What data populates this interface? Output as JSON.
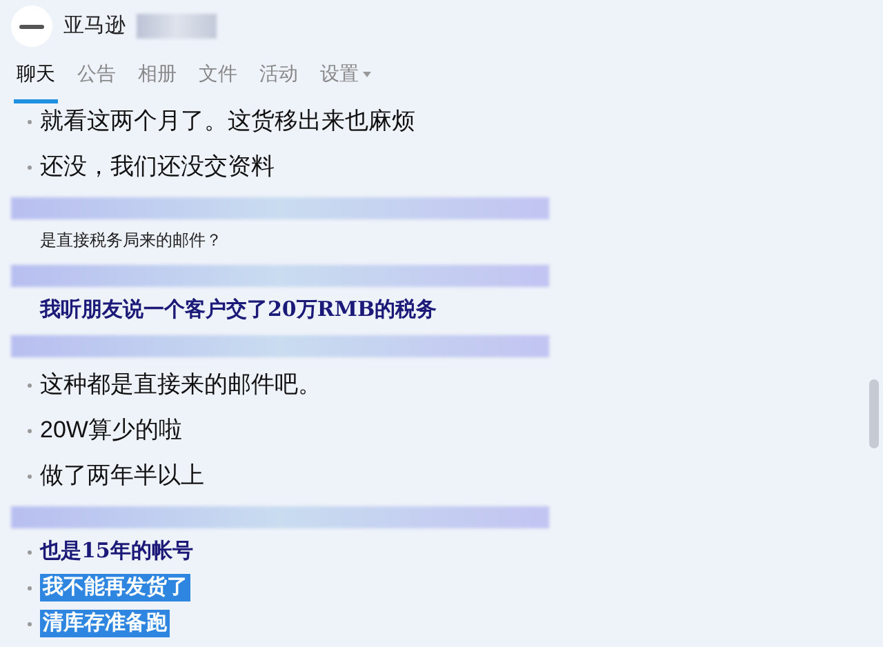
{
  "header": {
    "title": "亚马逊"
  },
  "tabs": [
    {
      "label": "聊天",
      "selected": true
    },
    {
      "label": "公告",
      "selected": false
    },
    {
      "label": "相册",
      "selected": false
    },
    {
      "label": "文件",
      "selected": false
    },
    {
      "label": "活动",
      "selected": false
    },
    {
      "label": "设置",
      "selected": false,
      "dropdown": true
    }
  ],
  "messages": [
    {
      "kind": "plain",
      "bullet": true,
      "selected": false,
      "text": "就看这两个月了。这货移出来也麻烦"
    },
    {
      "kind": "plain",
      "bullet": true,
      "selected": false,
      "text": "还没，我们还没交资料"
    },
    {
      "kind": "redacted"
    },
    {
      "kind": "small",
      "bullet": false,
      "selected": false,
      "text": "是直接税务局来的邮件？"
    },
    {
      "kind": "redacted"
    },
    {
      "kind": "emphasis",
      "bullet": false,
      "selected": false,
      "text": "我听朋友说一个客户交了20万RMB的税务"
    },
    {
      "kind": "redacted"
    },
    {
      "kind": "plain",
      "bullet": true,
      "selected": false,
      "text": "这种都是直接来的邮件吧。"
    },
    {
      "kind": "plain",
      "bullet": true,
      "selected": false,
      "text": "20W算少的啦"
    },
    {
      "kind": "plain",
      "bullet": true,
      "selected": false,
      "text": "做了两年半以上"
    },
    {
      "kind": "redacted"
    },
    {
      "kind": "emphasis",
      "bullet": true,
      "selected": false,
      "text": "也是15年的帐号"
    },
    {
      "kind": "emphasis",
      "bullet": true,
      "selected": true,
      "text": "我不能再发货了"
    },
    {
      "kind": "emphasis",
      "bullet": true,
      "selected": true,
      "text": "清库存准备跑"
    }
  ]
}
